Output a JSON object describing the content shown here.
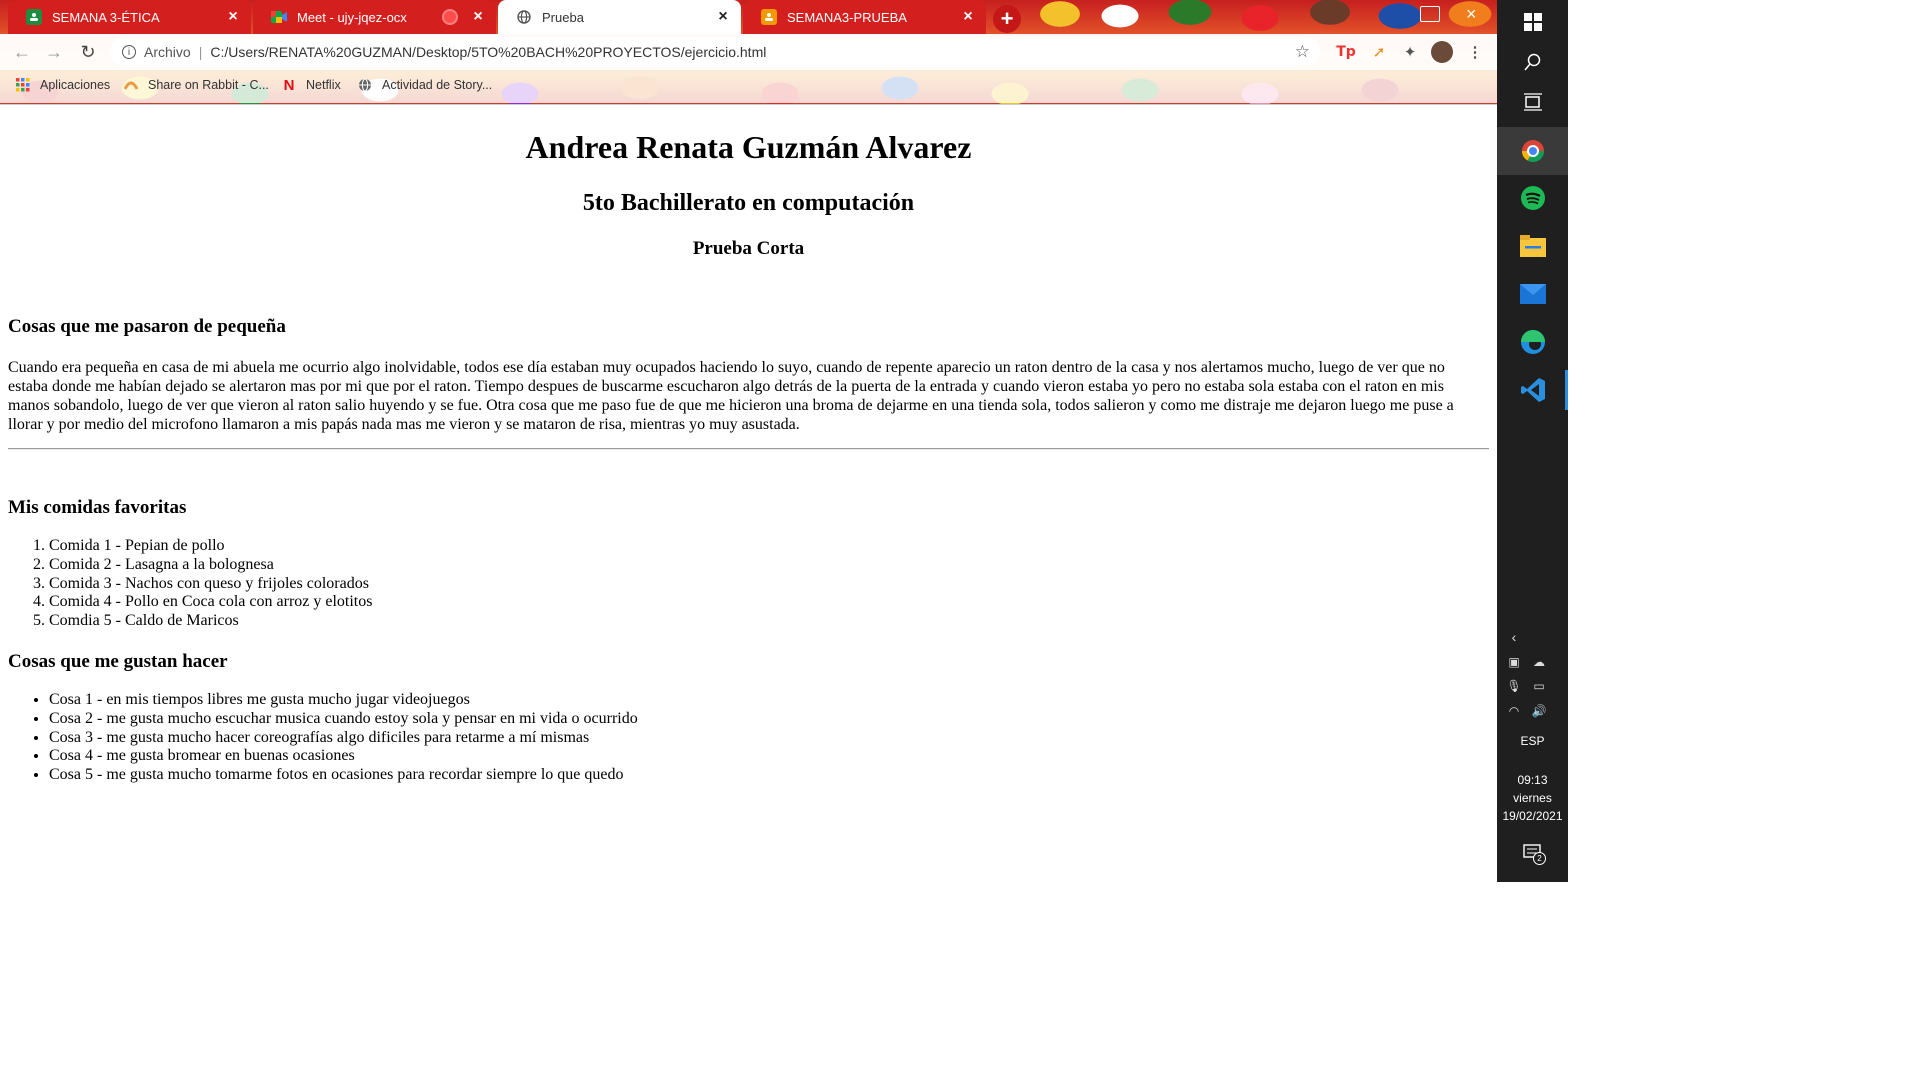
{
  "browser": {
    "tabs": [
      {
        "label": "SEMANA 3-ÉTICA",
        "icon": "classroom-icon",
        "state": "inactive"
      },
      {
        "label": "Meet - ujy-jqez-ocx",
        "icon": "meet-icon",
        "state": "inactive",
        "recording": true
      },
      {
        "label": "Prueba",
        "icon": "globe-icon",
        "state": "active"
      },
      {
        "label": "SEMANA3-PRUEBA",
        "icon": "classroom-icon",
        "state": "inactive"
      }
    ],
    "address": {
      "scheme_label": "Archivo",
      "url": "C:/Users/RENATA%20GUZMAN/Desktop/5TO%20BACH%20PROYECTOS/ejercicio.html"
    },
    "bookmarks": [
      {
        "label": "Aplicaciones",
        "icon": "apps-grid-icon"
      },
      {
        "label": "Share on Rabbit - C...",
        "icon": "rabbit-icon"
      },
      {
        "label": "Netflix",
        "icon": "netflix-icon"
      },
      {
        "label": "Actividad de Story...",
        "icon": "globe-icon"
      }
    ]
  },
  "page": {
    "title": "Andrea Renata Guzmán Alvarez",
    "subtitle": "5to Bachillerato en computación",
    "heading3": "Prueba Corta",
    "section1": {
      "title": "Cosas que me pasaron de pequeña",
      "text": "Cuando era pequeña en casa de mi abuela me ocurrio algo inolvidable, todos ese día estaban muy ocupados haciendo lo suyo, cuando de repente aparecio un raton dentro de la casa y nos alertamos mucho, luego de ver que no estaba donde me habían dejado se alertaron mas por mi que por el raton. Tiempo despues de buscarme escucharon algo detrás de la puerta de la entrada y cuando vieron estaba yo pero no estaba sola estaba con el raton en mis manos sobandolo, luego de ver que vieron al raton salio huyendo y se fue. Otra cosa que me paso fue de que me hicieron una broma de dejarme en una tienda sola, todos salieron y como me distraje me dejaron luego me puse a llorar y por medio del microfono llamaron a mis papás nada mas me vieron y se mataron de risa, mientras yo muy asustada."
    },
    "section2": {
      "title": "Mis comidas favoritas",
      "items": [
        "Comida 1 - Pepian de pollo",
        "Comida 2 - Lasagna a la bolognesa",
        "Comida 3 - Nachos con queso y frijoles colorados",
        "Comida 4 - Pollo en Coca cola con arroz y elotitos",
        "Comdia 5 - Caldo de Maricos"
      ]
    },
    "section3": {
      "title": "Cosas que me gustan hacer",
      "items": [
        "Cosa 1 - en mis tiempos libres me gusta mucho jugar videojuegos",
        "Cosa 2 - me gusta mucho escuchar musica cuando estoy sola y pensar en mi vida o ocurrido",
        "Cosa 3 - me gusta mucho hacer coreografías algo dificiles para retarme a mí mismas",
        "Cosa 4 - me gusta bromear en buenas ocasiones",
        "Cosa 5 - me gusta mucho tomarme fotos en ocasiones para recordar siempre lo que quedo"
      ]
    }
  },
  "taskbar": {
    "language": "ESP",
    "time": "09:13",
    "day": "viernes",
    "date": "19/02/2021",
    "notification_count": "2"
  },
  "colors": {
    "tab_inactive": "#d41f1f",
    "taskbar": "#1f1f1f",
    "accent_vscode": "#2b8fe0"
  }
}
